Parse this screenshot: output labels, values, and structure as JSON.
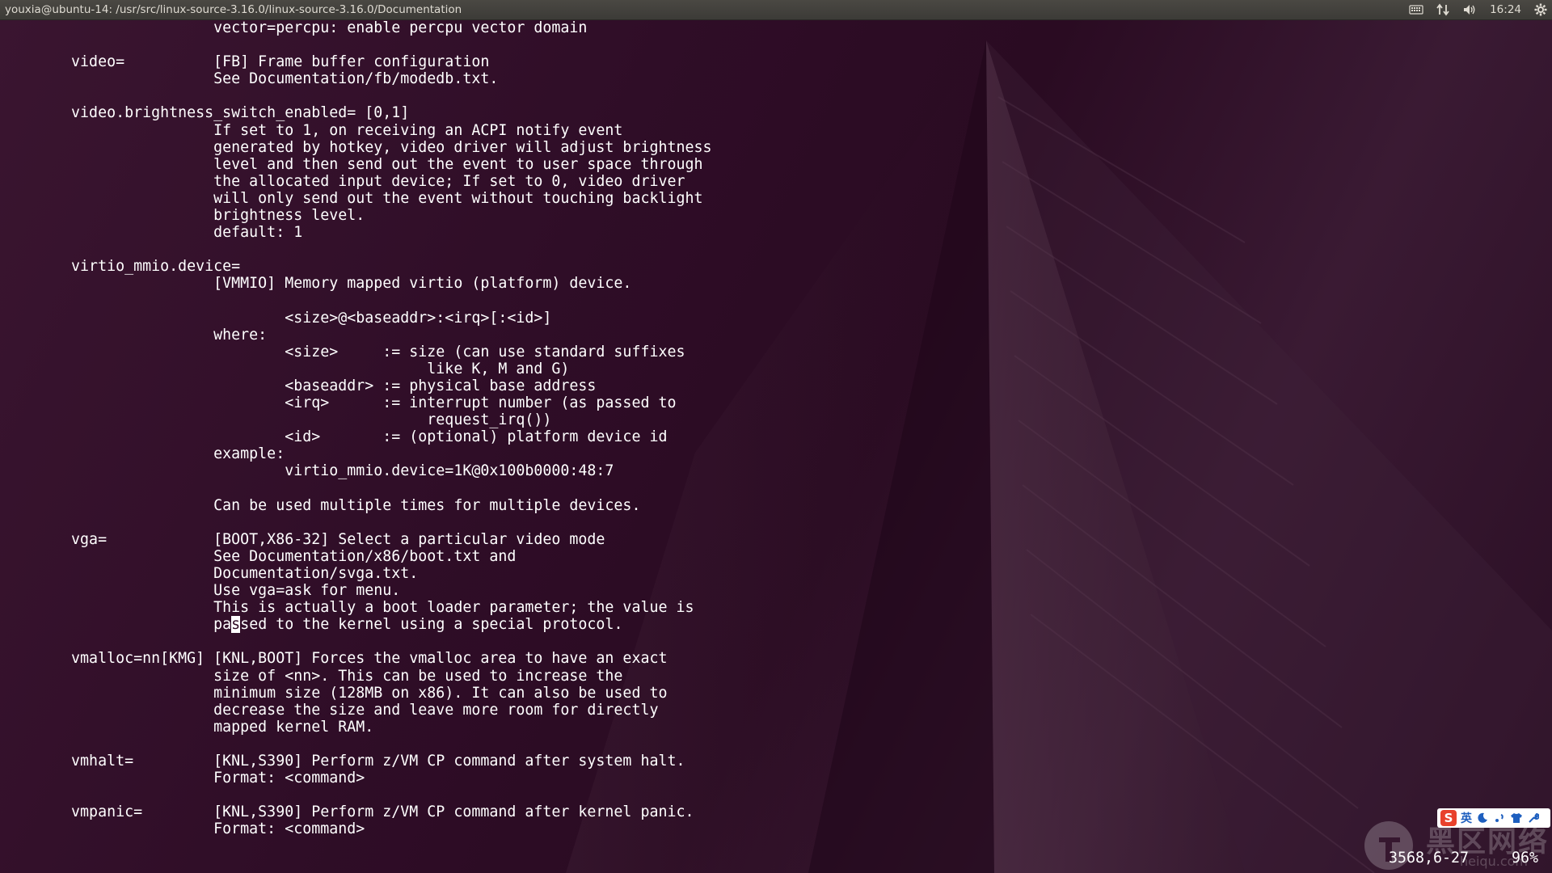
{
  "window": {
    "title": "youxia@ubuntu-14: /usr/src/linux-source-3.16.0/linux-source-3.16.0/Documentation"
  },
  "indicators": {
    "keyboard_icon": "keyboard-icon",
    "network_icon": "network-arrows-icon",
    "volume_icon": "volume-icon",
    "clock": "16:24",
    "settings_icon": "gear-icon"
  },
  "terminal": {
    "lines_before_cursor": "                        vector=percpu: enable percpu vector domain\n\n        video=          [FB] Frame buffer configuration\n                        See Documentation/fb/modedb.txt.\n\n        video.brightness_switch_enabled= [0,1]\n                        If set to 1, on receiving an ACPI notify event\n                        generated by hotkey, video driver will adjust brightness\n                        level and then send out the event to user space through\n                        the allocated input device; If set to 0, video driver\n                        will only send out the event without touching backlight\n                        brightness level.\n                        default: 1\n\n        virtio_mmio.device=\n                        [VMMIO] Memory mapped virtio (platform) device.\n\n                                <size>@<baseaddr>:<irq>[:<id>]\n                        where:\n                                <size>     := size (can use standard suffixes\n                                                like K, M and G)\n                                <baseaddr> := physical base address\n                                <irq>      := interrupt number (as passed to\n                                                request_irq())\n                                <id>       := (optional) platform device id\n                        example:\n                                virtio_mmio.device=1K@0x100b0000:48:7\n\n                        Can be used multiple times for multiple devices.\n\n        vga=            [BOOT,X86-32] Select a particular video mode\n                        See Documentation/x86/boot.txt and\n                        Documentation/svga.txt.\n                        Use vga=ask for menu.\n                        This is actually a boot loader parameter; the value is\n                        pa",
    "cursor_char": "s",
    "lines_after_cursor": "sed to the kernel using a special protocol.\n\n        vmalloc=nn[KMG] [KNL,BOOT] Forces the vmalloc area to have an exact\n                        size of <nn>. This can be used to increase the\n                        minimum size (128MB on x86). It can also be used to\n                        decrease the size and leave more room for directly\n                        mapped kernel RAM.\n\n        vmhalt=         [KNL,S390] Perform z/VM CP command after system halt.\n                        Format: <command>\n\n        vmpanic=        [KNL,S390] Perform z/VM CP command after kernel panic.\n                        Format: <command>",
    "status_position": "3568,6-27",
    "status_percent": "96%"
  },
  "ime": {
    "logo_icon": "sogou-s-icon",
    "mode_label": "英",
    "tools": [
      "moon-icon",
      "punctuation-icon",
      "shirt-icon",
      "wrench-icon"
    ]
  },
  "watermark": {
    "text": "黑区网络",
    "sub": "heiqu.com"
  }
}
